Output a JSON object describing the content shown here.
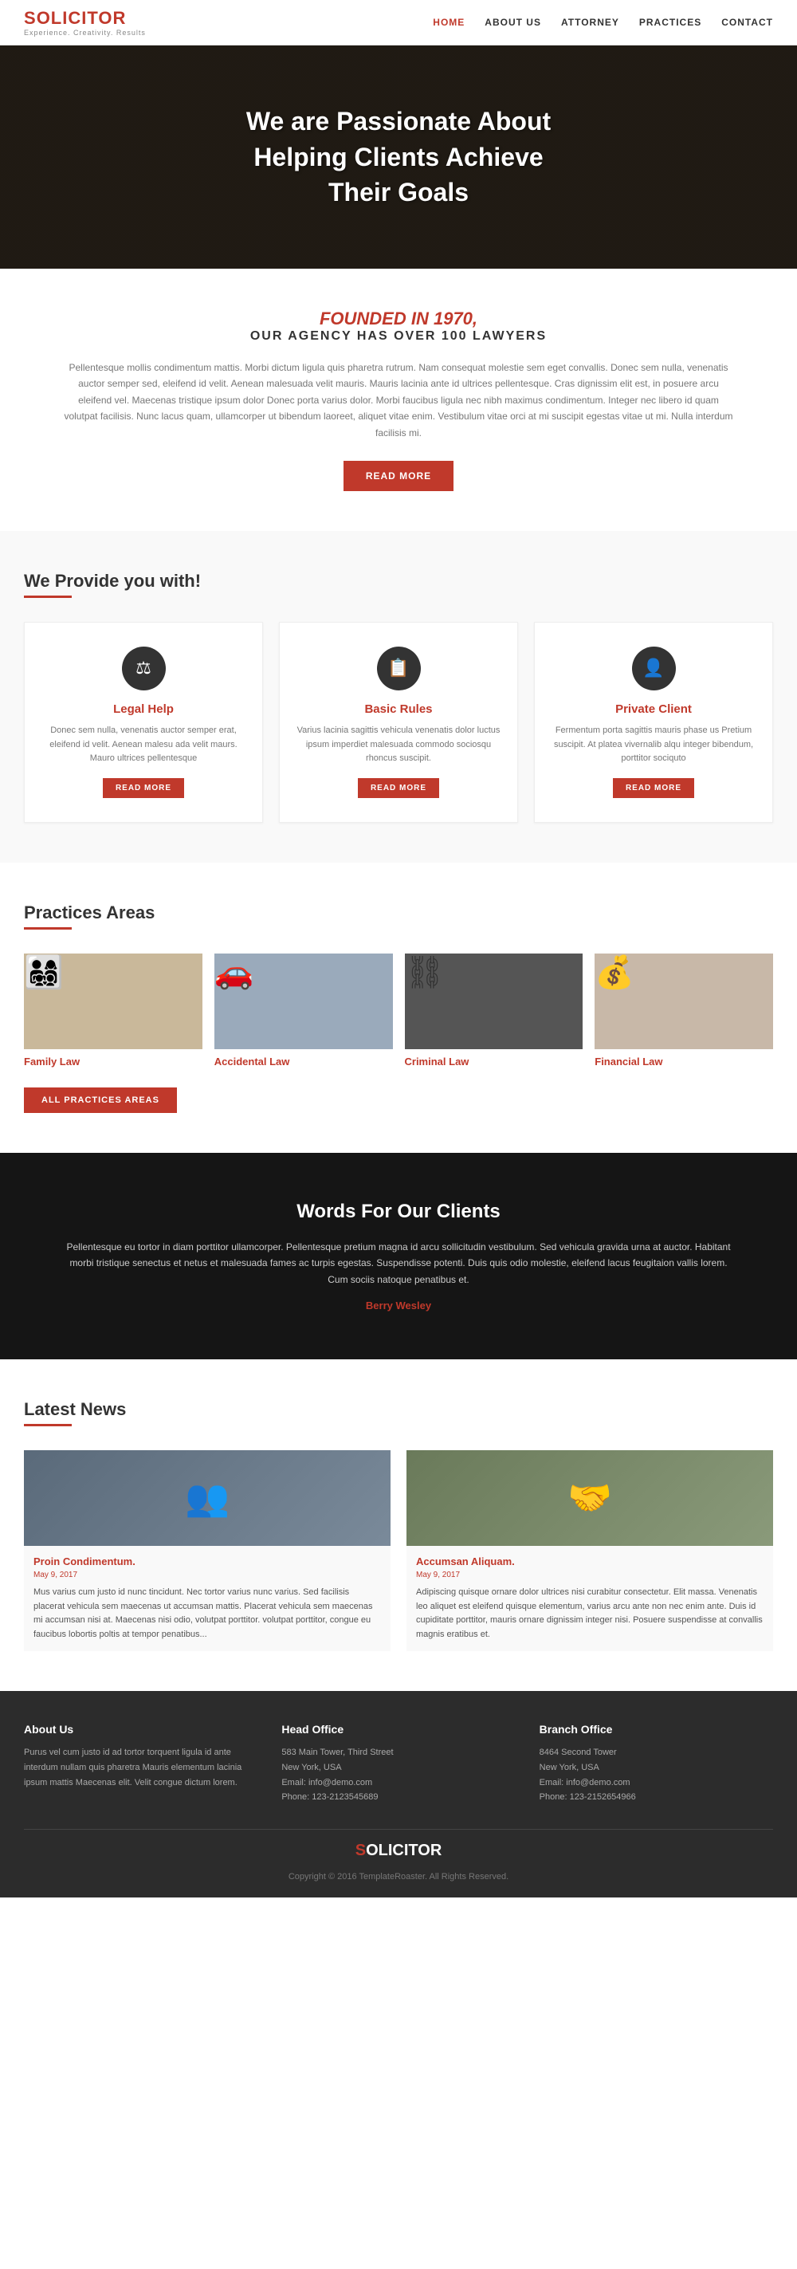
{
  "nav": {
    "logo": "S",
    "logo_rest": "OLICITOR",
    "logo_sub": "Experience. Creativity. Results",
    "links": [
      {
        "label": "HOME",
        "active": true
      },
      {
        "label": "ABOUT US",
        "active": false
      },
      {
        "label": "ATTORNEY",
        "active": false
      },
      {
        "label": "PRACTICES",
        "active": false
      },
      {
        "label": "CONTACT",
        "active": false
      }
    ]
  },
  "hero": {
    "line1": "We are Passionate About",
    "line2": "Helping Clients Achieve",
    "line3": "Their Goals"
  },
  "founded": {
    "heading1": "FOUNDED IN 1970,",
    "heading2": "OUR AGENCY HAS OVER 100 LAWYERS",
    "body": "Pellentesque mollis condimentum mattis. Morbi dictum ligula quis pharetra rutrum. Nam consequat molestie sem eget convallis. Donec sem nulla, venenatis auctor semper sed, eleifend id velit. Aenean malesuada velit mauris. Mauris lacinia ante id ultrices pellentesque. Cras dignissim elit est, in posuere arcu eleifend vel. Maecenas tristique ipsum dolor Donec porta varius dolor. Morbi faucibus ligula nec nibh maximus condimentum. Integer nec libero id quam volutpat facilisis. Nunc lacus quam, ullamcorper ut bibendum laoreet, aliquet vitae enim. Vestibulum vitae orci at mi suscipit egestas vitae ut mi. Nulla interdum facilisis mi.",
    "btn": "READ MORE"
  },
  "provides": {
    "heading": "We Provide you with!",
    "cards": [
      {
        "icon": "⚖",
        "title": "Legal Help",
        "body": "Donec sem nulla, venenatis auctor semper erat, eleifend id velit. Aenean malesu ada velit maurs. Mauro ultrices pellentesque",
        "btn": "READ MORE"
      },
      {
        "icon": "📋",
        "title": "Basic Rules",
        "body": "Varius lacinia sagittis vehicula venenatis dolor luctus ipsum imperdiet malesuada commodo sociosqu rhoncus suscipit.",
        "btn": "READ MORE"
      },
      {
        "icon": "👤",
        "title": "Private Client",
        "body": "Fermentum porta sagittis mauris phase us Pretium suscipit. At platea vivernalib alqu integer bibendum, porttitor sociquto",
        "btn": "READ MORE"
      }
    ]
  },
  "practices": {
    "heading": "Practices Areas",
    "items": [
      {
        "label": "Family Law",
        "emoji": "👨‍👩‍👧‍👦"
      },
      {
        "label": "Accidental Law",
        "emoji": "🚗"
      },
      {
        "label": "Criminal Law",
        "emoji": "⛓"
      },
      {
        "label": "Financial Law",
        "emoji": "💰"
      }
    ],
    "btn": "ALL PRACTICES AREAS"
  },
  "testimonials": {
    "heading": "Words For Our Clients",
    "body": "Pellentesque eu tortor in diam porttitor ullamcorper. Pellentesque pretium magna id arcu sollicitudin vestibulum. Sed vehicula gravida urna at auctor. Habitant morbi tristique senectus et netus et malesuada fames ac turpis egestas. Suspendisse potenti. Duis quis odio molestie, eleifend lacus feugitaion vallis lorem. Cum sociis natoque penatibus et.",
    "author": "Berry Wesley"
  },
  "news": {
    "heading": "Latest News",
    "items": [
      {
        "title": "Proin Condimentum.",
        "date": "May 9, 2017",
        "body": "Mus varius cum justo id nunc tincidunt. Nec tortor varius nunc varius. Sed facilisis placerat vehicula sem maecenas ut accumsan mattis. Placerat vehicula sem maecenas mi accumsan nisi at. Maecenas nisi odio, volutpat porttitor. volutpat porttitor, congue eu faucibus lobortis poltis at tempor penatibus...",
        "emoji": "👥"
      },
      {
        "title": "Accumsan Aliquam.",
        "date": "May 9, 2017",
        "body": "Adipiscing quisque ornare dolor ultrices nisi curabitur consectetur. Elit massa. Venenatis leo aliquet est eleifend quisque elementum, varius arcu ante non nec enim ante. Duis id cupiditate porttitor, mauris ornare dignissim integer nisi. Posuere suspendisse at convallis magnis eratibus et.",
        "emoji": "🤝"
      }
    ]
  },
  "footer": {
    "cols": [
      {
        "heading": "About Us",
        "body": "Purus vel cum justo id ad tortor torquent ligula id ante interdum nullam quis pharetra Mauris elementum lacinia ipsum mattis Maecenas elit. Velit congue dictum lorem."
      },
      {
        "heading": "Head Office",
        "body": "583 Main Tower, Third Street\nNew York, USA\nEmail: info@demo.com\nPhone: 123-2123545689"
      },
      {
        "heading": "Branch Office",
        "body": "8464 Second Tower\nNew York, USA\nEmail: info@demo.com\nPhone: 123-2152654966"
      }
    ],
    "logo": "S",
    "logo_rest": "OLICITOR",
    "copy": "Copyright © 2016 TemplateRoaster. All Rights Reserved."
  }
}
